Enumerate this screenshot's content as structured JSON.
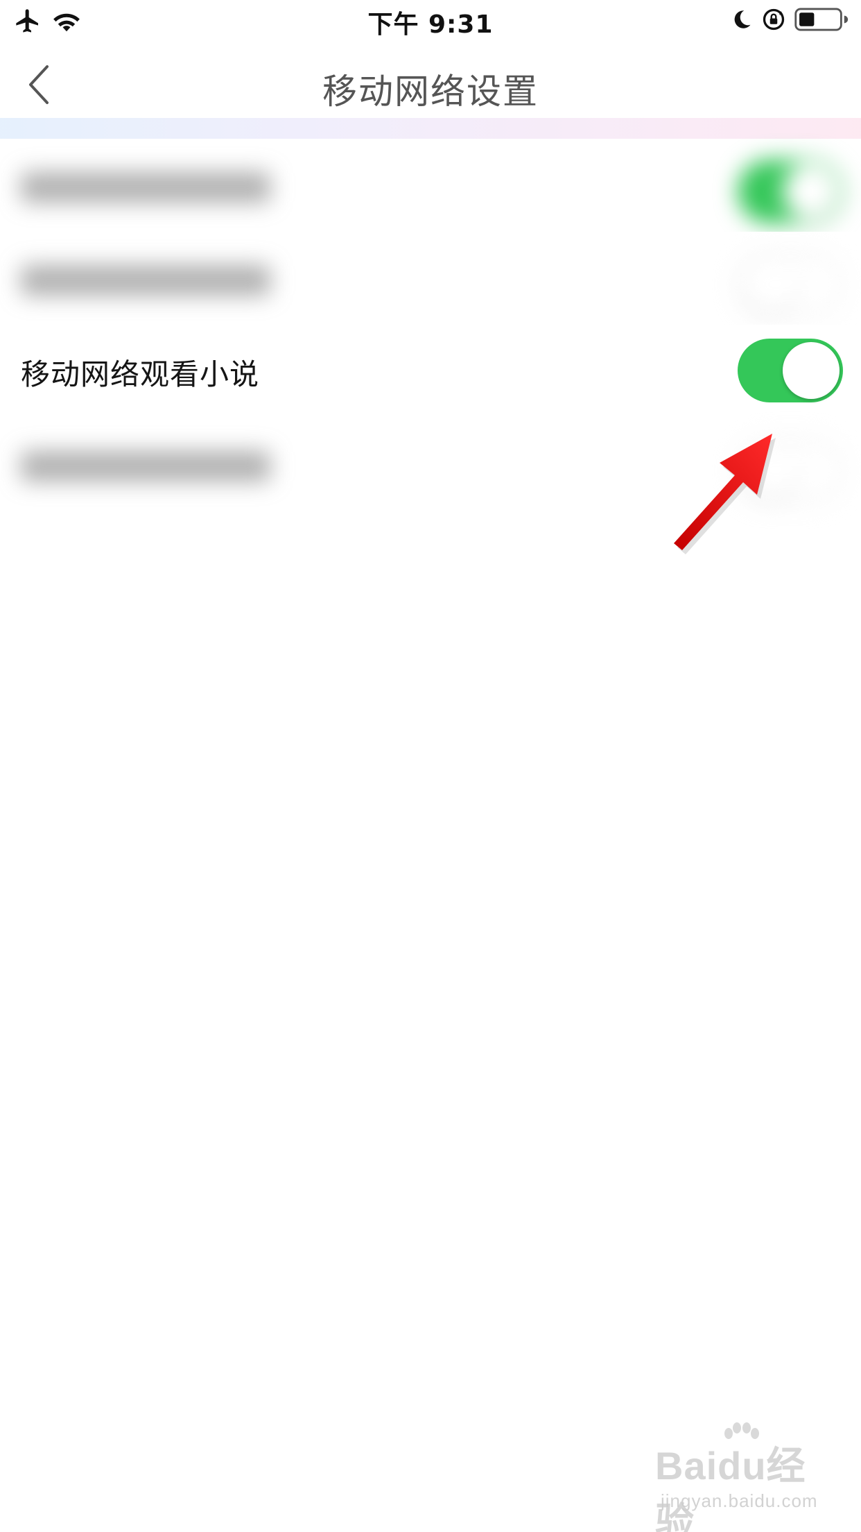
{
  "status_bar": {
    "time": "下午 9:31",
    "icons": [
      "airplane-icon",
      "wifi-icon",
      "moon-icon",
      "rotation-lock-icon",
      "battery-icon"
    ]
  },
  "nav": {
    "back_icon": "chevron-left-icon",
    "title": "移动网络设置"
  },
  "settings": {
    "rows": [
      {
        "label": "",
        "blurred": true,
        "toggle": "on"
      },
      {
        "label": "",
        "blurred": true,
        "toggle": "off"
      },
      {
        "label": "移动网络观看小说",
        "blurred": false,
        "toggle": "on"
      },
      {
        "label": "",
        "blurred": true,
        "toggle": "off"
      }
    ]
  },
  "annotation": {
    "arrow_color": "#ee1111"
  },
  "watermark": {
    "brand": "Baidu经验",
    "url": "jingyan.baidu.com"
  },
  "colors": {
    "toggle_on": "#34c759",
    "title_text": "#555555"
  }
}
